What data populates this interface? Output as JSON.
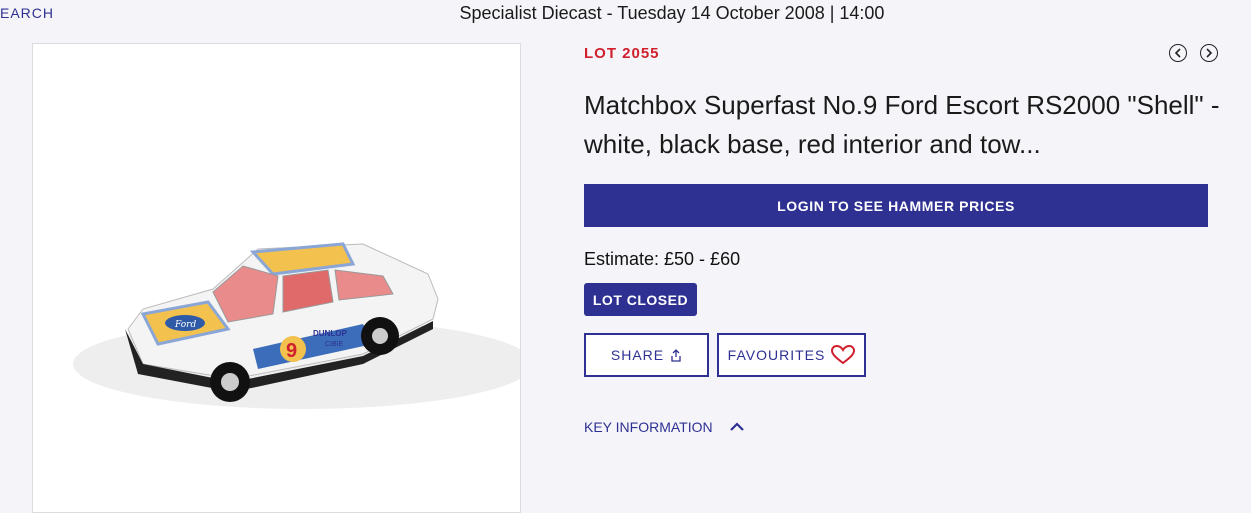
{
  "nav": {
    "search_label": "EARCH"
  },
  "header": {
    "title": "Specialist Diecast - Tuesday 14 October 2008 | 14:00"
  },
  "lot": {
    "number_label": "LOT 2055",
    "title": "Matchbox Superfast No.9 Ford Escort RS2000 \"Shell\" - white, black base, red interior and tow...",
    "estimate": "Estimate: £50 - £60",
    "status": "LOT CLOSED"
  },
  "actions": {
    "login_prices": "LOGIN TO SEE HAMMER PRICES",
    "share": "SHARE",
    "favourites": "FAVOURITES"
  },
  "key_information": {
    "label": "KEY INFORMATION"
  },
  "image": {
    "car_number": "9",
    "decal_brand_1": "Ford",
    "decal_brand_2": "DUNLOP",
    "decal_brand_3": "CIBIE"
  },
  "colors": {
    "accent": "#2e3192",
    "lot_red": "#d0202e",
    "heart_red": "#d0202e"
  },
  "icons": {
    "prev": "chevron-left-icon",
    "next": "chevron-right-icon",
    "share": "share-icon",
    "favourite": "heart-icon",
    "collapse": "chevron-up-icon"
  }
}
